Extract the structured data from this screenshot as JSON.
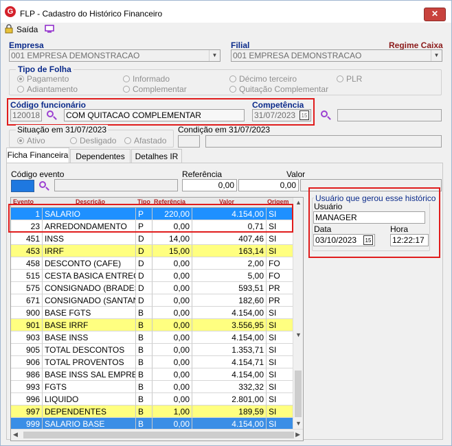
{
  "window": {
    "title": "FLP - Cadastro do Histórico Financeiro",
    "close": "✕"
  },
  "toolbar": {
    "exit_label": "Saída"
  },
  "empresa": {
    "label": "Empresa",
    "value": "001 EMPRESA DEMONSTRACAO"
  },
  "filial": {
    "label": "Filial",
    "value": "001 EMPRESA DEMONSTRACAO",
    "regime": "Regime Caixa"
  },
  "tipo_folha": {
    "label": "Tipo de Folha",
    "options": [
      "Pagamento",
      "Informado",
      "Décimo terceiro",
      "PLR",
      "Adiantamento",
      "Complementar",
      "Quitação Complementar"
    ],
    "selected": "Pagamento"
  },
  "funcionario": {
    "label": "Código funcionário",
    "code": "120018",
    "name": "COM QUITACAO COMPLEMENTAR"
  },
  "competencia": {
    "label": "Competência",
    "value": "31/07/2023"
  },
  "situacao": {
    "label": "Situação em 31/07/2023",
    "options": [
      "Ativo",
      "Desligado",
      "Afastado"
    ],
    "selected": "Ativo"
  },
  "condicao": {
    "label": "Condição em 31/07/2023"
  },
  "tabs": [
    "Ficha Financeira",
    "Dependentes",
    "Detalhes IR"
  ],
  "filters": {
    "codigo_evento_label": "Código evento",
    "referencia_label": "Referência",
    "referencia_value": "0,00",
    "valor_label": "Valor",
    "valor_value": "0,00"
  },
  "grid": {
    "headers": [
      "Evento",
      "Descrição",
      "Tipo",
      "Referência",
      "Valor",
      "Origem"
    ],
    "rows": [
      {
        "evento": "1",
        "descricao": "SALARIO",
        "tipo": "P",
        "referencia": "220,00",
        "valor": "4.154,00",
        "origem": "SI",
        "style": "selected"
      },
      {
        "evento": "23",
        "descricao": "ARREDONDAMENTO",
        "tipo": "P",
        "referencia": "0,00",
        "valor": "0,71",
        "origem": "SI",
        "style": "white"
      },
      {
        "evento": "451",
        "descricao": "INSS",
        "tipo": "D",
        "referencia": "14,00",
        "valor": "407,46",
        "origem": "SI",
        "style": "white"
      },
      {
        "evento": "453",
        "descricao": "IRRF",
        "tipo": "D",
        "referencia": "15,00",
        "valor": "163,14",
        "origem": "SI",
        "style": "yellow"
      },
      {
        "evento": "458",
        "descricao": "DESCONTO (CAFE)",
        "tipo": "D",
        "referencia": "0,00",
        "valor": "2,00",
        "origem": "FO",
        "style": "white"
      },
      {
        "evento": "515",
        "descricao": "CESTA BASICA ENTREGA",
        "tipo": "D",
        "referencia": "0,00",
        "valor": "5,00",
        "origem": "FO",
        "style": "white"
      },
      {
        "evento": "575",
        "descricao": "CONSIGNADO (BRADES...",
        "tipo": "D",
        "referencia": "0,00",
        "valor": "593,51",
        "origem": "PR",
        "style": "white"
      },
      {
        "evento": "671",
        "descricao": "CONSIGNADO (SANTAN...",
        "tipo": "D",
        "referencia": "0,00",
        "valor": "182,60",
        "origem": "PR",
        "style": "white"
      },
      {
        "evento": "900",
        "descricao": "BASE FGTS",
        "tipo": "B",
        "referencia": "0,00",
        "valor": "4.154,00",
        "origem": "SI",
        "style": "white"
      },
      {
        "evento": "901",
        "descricao": "BASE IRRF",
        "tipo": "B",
        "referencia": "0,00",
        "valor": "3.556,95",
        "origem": "SI",
        "style": "yellow"
      },
      {
        "evento": "903",
        "descricao": "BASE INSS",
        "tipo": "B",
        "referencia": "0,00",
        "valor": "4.154,00",
        "origem": "SI",
        "style": "white"
      },
      {
        "evento": "905",
        "descricao": "TOTAL DESCONTOS",
        "tipo": "B",
        "referencia": "0,00",
        "valor": "1.353,71",
        "origem": "SI",
        "style": "white"
      },
      {
        "evento": "906",
        "descricao": "TOTAL PROVENTOS",
        "tipo": "B",
        "referencia": "0,00",
        "valor": "4.154,71",
        "origem": "SI",
        "style": "white"
      },
      {
        "evento": "986",
        "descricao": "BASE INSS SAL EMPRE...",
        "tipo": "B",
        "referencia": "0,00",
        "valor": "4.154,00",
        "origem": "SI",
        "style": "white"
      },
      {
        "evento": "993",
        "descricao": "FGTS",
        "tipo": "B",
        "referencia": "0,00",
        "valor": "332,32",
        "origem": "SI",
        "style": "white"
      },
      {
        "evento": "996",
        "descricao": "LIQUIDO",
        "tipo": "B",
        "referencia": "0,00",
        "valor": "2.801,00",
        "origem": "SI",
        "style": "white"
      },
      {
        "evento": "997",
        "descricao": "DEPENDENTES",
        "tipo": "B",
        "referencia": "1,00",
        "valor": "189,59",
        "origem": "SI",
        "style": "yellow"
      },
      {
        "evento": "999",
        "descricao": "SALARIO BASE",
        "tipo": "B",
        "referencia": "0,00",
        "valor": "4.154,00",
        "origem": "SI",
        "style": "blue"
      }
    ]
  },
  "usuario_box": {
    "title": "Usuário que gerou esse histórico",
    "usuario_label": "Usuário",
    "usuario_value": "MANAGER",
    "data_label": "Data",
    "data_value": "03/10/2023",
    "hora_label": "Hora",
    "hora_value": "12:22:17"
  },
  "colors": {
    "selected_row": "#1e90ff",
    "yellow_row": "#ffff80",
    "blue_row": "#3a8ee6",
    "label_blue": "#0a2a8a",
    "highlight": "#e01b1b"
  }
}
